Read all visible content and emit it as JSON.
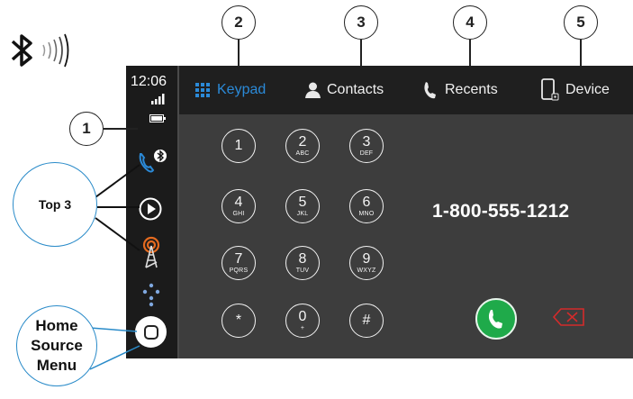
{
  "status": {
    "time": "12:06"
  },
  "tabs": [
    {
      "label": "Keypad",
      "icon": "keypad-grid-icon",
      "active": true
    },
    {
      "label": "Contacts",
      "icon": "person-icon",
      "active": false
    },
    {
      "label": "Recents",
      "icon": "phone-handset-icon",
      "active": false
    },
    {
      "label": "Device",
      "icon": "smartphone-icon",
      "active": false
    }
  ],
  "keypad": [
    {
      "digit": "1",
      "letters": ""
    },
    {
      "digit": "2",
      "letters": "ABC"
    },
    {
      "digit": "3",
      "letters": "DEF"
    },
    {
      "digit": "4",
      "letters": "GHI"
    },
    {
      "digit": "5",
      "letters": "JKL"
    },
    {
      "digit": "6",
      "letters": "MNO"
    },
    {
      "digit": "7",
      "letters": "PQRS"
    },
    {
      "digit": "8",
      "letters": "TUV"
    },
    {
      "digit": "9",
      "letters": "WXYZ"
    },
    {
      "digit": "*",
      "letters": ""
    },
    {
      "digit": "0",
      "letters": "+"
    },
    {
      "digit": "#",
      "letters": ""
    }
  ],
  "dialed_number": "1-800-555-1212",
  "annotations": {
    "callout_1": "1",
    "callout_2": "2",
    "callout_3": "3",
    "callout_4": "4",
    "callout_5": "5",
    "top3_label": "Top 3",
    "home_line1": "Home",
    "home_line2": "Source",
    "home_line3": "Menu"
  },
  "colors": {
    "active_tab": "#2b8ad8",
    "call_button": "#1faa4a",
    "backspace": "#d42b2b",
    "callout_ring": "#2a8bc9"
  }
}
